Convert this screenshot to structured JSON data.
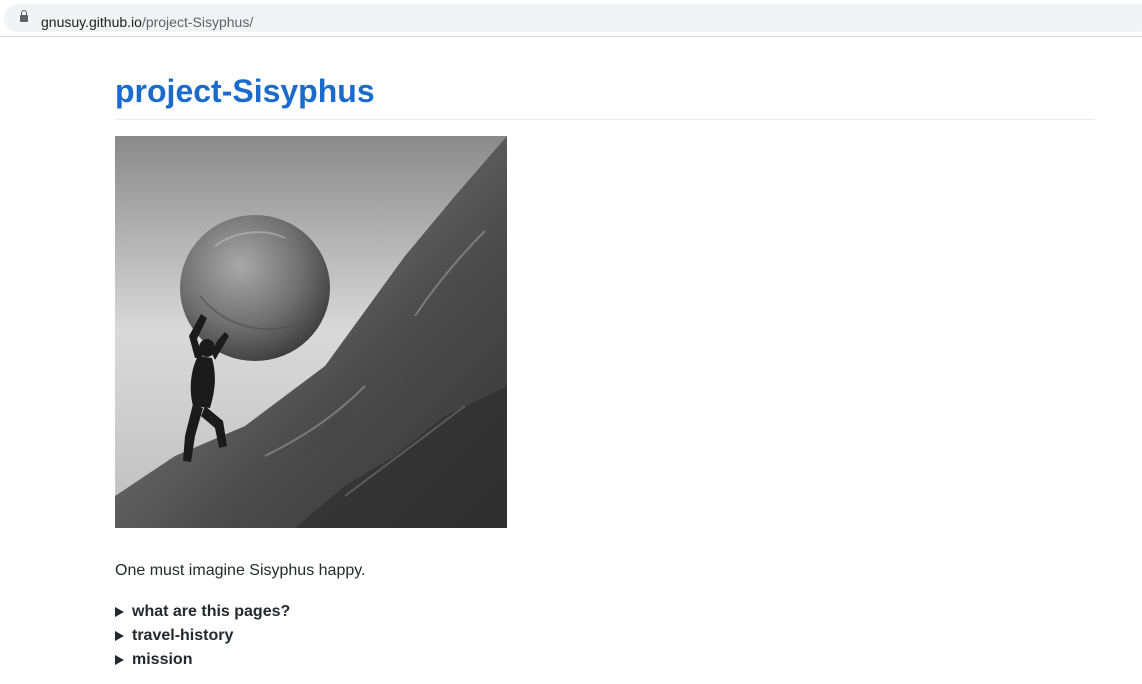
{
  "browser": {
    "url_host": "gnusuy.github.io",
    "url_path": "/project-Sisyphus/"
  },
  "page": {
    "title": "project-Sisyphus",
    "tagline": "One must imagine Sisyphus happy.",
    "details": [
      {
        "label": "what are this pages?"
      },
      {
        "label": "travel-history"
      },
      {
        "label": "mission"
      }
    ]
  },
  "colors": {
    "title": "#1a6bcc",
    "text": "#24292e",
    "omnibox_bg": "#f1f3f4"
  },
  "icons": [
    "lock-icon",
    "triangle-icon"
  ]
}
